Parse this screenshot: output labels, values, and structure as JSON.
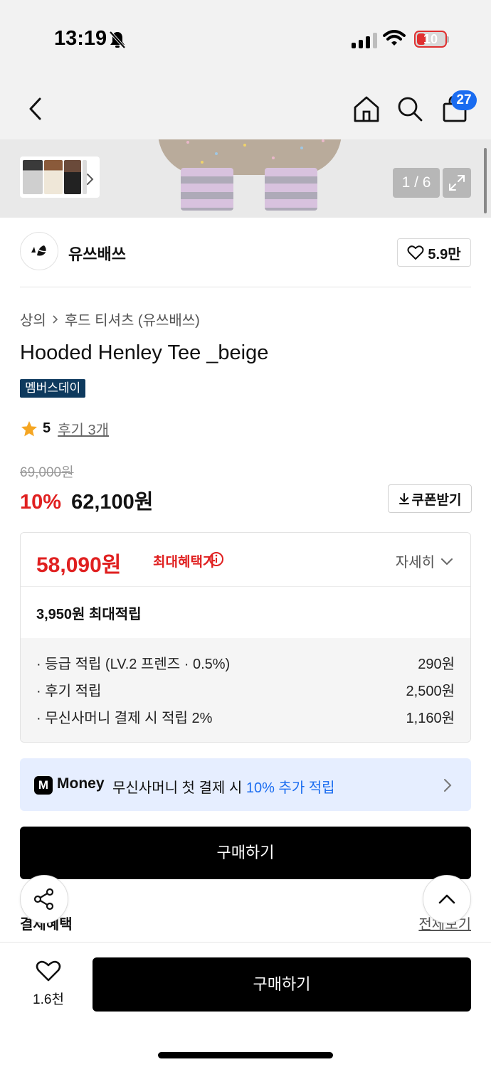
{
  "status_bar": {
    "time": "13:19",
    "battery": "10"
  },
  "nav": {
    "cart_count": "27"
  },
  "gallery": {
    "counter": "1 / 6"
  },
  "brand": {
    "name": "유쓰배쓰",
    "likes": "5.9만"
  },
  "breadcrumb": {
    "category": "상의",
    "subcategory": "후드 티셔츠 (유쓰배쓰)"
  },
  "product": {
    "title": "Hooded Henley Tee _beige",
    "badge": "멤버스데이",
    "rating": 5,
    "rating_score": "5",
    "review_link": "후기 3개",
    "original_price": "69,000원",
    "discount": "10%",
    "price": "62,100원",
    "coupon_label": "쿠폰받기"
  },
  "benefits": {
    "max_price": "58,090원",
    "max_label": "최대혜택가",
    "detail_label": "자세히",
    "points_total": "3,950원 최대적립",
    "rows": [
      {
        "label": "· 등급 적립 (LV.2 프렌즈 · 0.5%)",
        "value": "290원"
      },
      {
        "label": "· 후기 적립",
        "value": "2,500원"
      },
      {
        "label": "· 무신사머니 결제 시 적립 2%",
        "value": "1,160원"
      }
    ]
  },
  "money_banner": {
    "logo": "M",
    "brand": "Money",
    "text": "무신사머니 첫 결제 시 ",
    "highlight": "10% 추가 적립"
  },
  "buy_label": "구매하기",
  "payment": {
    "title": "결제혜택",
    "view_all": "전체보기"
  },
  "bottom": {
    "wish_count": "1.6천",
    "buy_label": "구매하기"
  },
  "colors": {
    "accent_red": "#e02020",
    "accent_blue": "#1a6cf0",
    "badge_navy": "#0e3a5e"
  }
}
